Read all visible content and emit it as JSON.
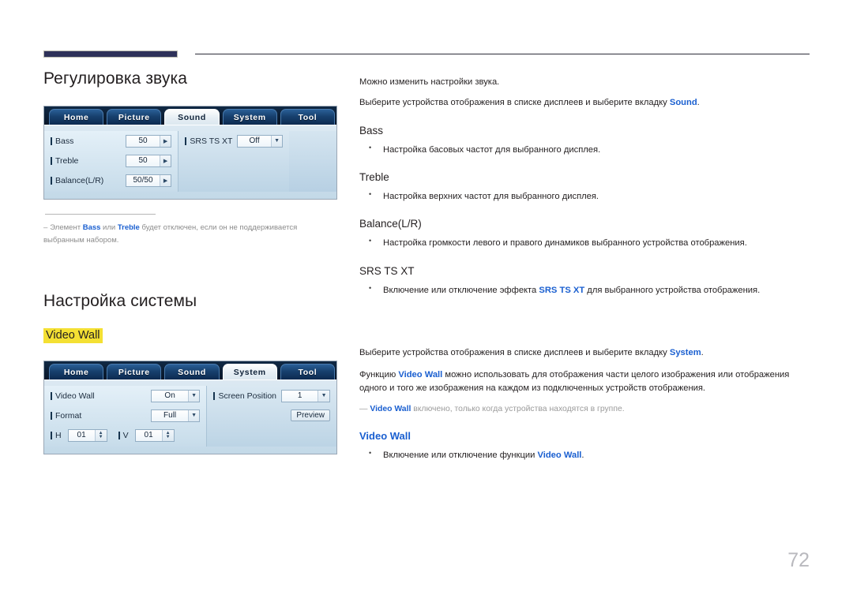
{
  "page": {
    "number": "72"
  },
  "sections": [
    {
      "title": "Регулировка звука",
      "panel": {
        "tabs": [
          {
            "label": "Home",
            "active": false
          },
          {
            "label": "Picture",
            "active": false
          },
          {
            "label": "Sound",
            "active": true
          },
          {
            "label": "System",
            "active": false
          },
          {
            "label": "Tool",
            "active": false
          }
        ],
        "left_rows": [
          {
            "label": "Bass",
            "value": "50",
            "control": "stepper-right"
          },
          {
            "label": "Treble",
            "value": "50",
            "control": "stepper-right"
          },
          {
            "label": "Balance(L/R)",
            "value": "50/50",
            "control": "stepper-right"
          }
        ],
        "mid_rows": [
          {
            "label": "SRS TS XT",
            "value": "Off",
            "control": "dropdown"
          }
        ]
      },
      "footnote": {
        "dash": "–",
        "text_1": "Элемент ",
        "bold_1": "Bass",
        "text_2": " или ",
        "bold_2": "Treble",
        "text_3": " будет отключен, если он не поддерживается выбранным набором."
      }
    },
    {
      "title": "Настройка системы",
      "highlight_label": "Video Wall",
      "panel": {
        "tabs": [
          {
            "label": "Home",
            "active": false
          },
          {
            "label": "Picture",
            "active": false
          },
          {
            "label": "Sound",
            "active": false
          },
          {
            "label": "System",
            "active": true
          },
          {
            "label": "Tool",
            "active": false
          }
        ],
        "left_rows": [
          {
            "label": "Video Wall",
            "value": "On",
            "control": "dropdown"
          },
          {
            "label": "Format",
            "value": "Full",
            "control": "dropdown"
          }
        ],
        "hv_row": {
          "h_label": "H",
          "h_value": "01",
          "v_label": "V",
          "v_value": "01"
        },
        "right_rows": [
          {
            "label": "Screen Position",
            "value": "1",
            "control": "dropdown"
          }
        ],
        "preview_button": "Preview"
      }
    }
  ],
  "right": {
    "sound": {
      "intro_1": "Можно изменить настройки звука.",
      "intro_2_a": "Выберите устройства отображения в списке дисплеев и выберите вкладку ",
      "intro_2_blue": "Sound",
      "intro_2_b": ".",
      "items": [
        {
          "heading": "Bass",
          "bullet": "Настройка басовых частот для выбранного дисплея."
        },
        {
          "heading": "Treble",
          "bullet": "Настройка верхних частот для выбранного дисплея."
        },
        {
          "heading": "Balance(L/R)",
          "bullet": "Настройка громкости левого и правого динамиков выбранного устройства отображения."
        }
      ],
      "srs": {
        "heading": "SRS TS XT",
        "bullet_a": "Включение или отключение эффекта ",
        "bullet_blue": "SRS TS XT",
        "bullet_b": " для выбранного устройства отображения."
      }
    },
    "system": {
      "intro_1_a": "Выберите устройства отображения в списке дисплеев и выберите вкладку ",
      "intro_1_blue": "System",
      "intro_1_b": ".",
      "intro_2_a": "Функцию ",
      "intro_2_blue": "Video Wall",
      "intro_2_b": " можно использовать для отображения части целого изображения или отображения одного и того же изображения на каждом из подключенных устройств отображения.",
      "note_dash": "—",
      "note_blue": "Video Wall",
      "note_text": " включено, только когда устройства находятся в группе.",
      "heading": "Video Wall",
      "bullet_a": "Включение или отключение функции ",
      "bullet_blue": "Video Wall",
      "bullet_b": "."
    }
  },
  "colors": {
    "accent_blue": "#1a5fd0",
    "highlight_yellow": "#f4e033",
    "rule_navy": "#2e3159",
    "page_num_gray": "#b9b9be"
  }
}
